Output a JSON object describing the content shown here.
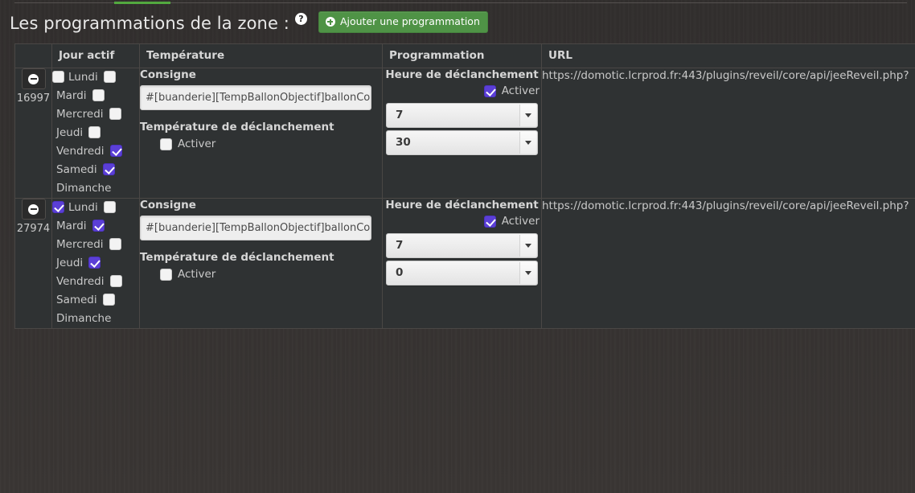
{
  "tabstrip": {
    "active_tab_color": "#53a93f"
  },
  "header": {
    "title": "Les programmations de la zone :",
    "help_icon": "question-mark-circle-icon",
    "add_button_label": "Ajouter une programmation",
    "add_button_color": "#4f9346"
  },
  "table": {
    "columns": [
      "",
      "Jour actif",
      "Température",
      "Programmation",
      "URL"
    ],
    "rows": [
      {
        "id": "16997",
        "remove_icon": "minus-circle-icon",
        "days": [
          {
            "label": "Lundi",
            "checked": false
          },
          {
            "label": "Mardi",
            "checked": false
          },
          {
            "label": "Mercredi",
            "checked": false
          },
          {
            "label": "Jeudi",
            "checked": false
          },
          {
            "label": "Vendredi",
            "checked": false
          },
          {
            "label": "Samedi",
            "checked": true
          },
          {
            "label": "Dimanche",
            "checked": true
          }
        ],
        "temperature": {
          "consigne_label": "Consigne",
          "consigne_value": "#[buanderie][TempBallonObjectif]ballonConsigne",
          "consigne_placeholder": "Consigne",
          "trigger_label": "Température de déclanchement",
          "trigger_activer_label": "Activer",
          "trigger_activer_checked": false
        },
        "programmation": {
          "heading": "Heure de déclanchement",
          "activer_label": "Activer",
          "activer_checked": true,
          "hour": "7",
          "minute": "30"
        },
        "url": "https://domotic.lcrprod.fr:443/plugins/reveil/core/api/jeeReveil.php?"
      },
      {
        "id": "27974",
        "remove_icon": "minus-circle-icon",
        "days": [
          {
            "label": "Lundi",
            "checked": true
          },
          {
            "label": "Mardi",
            "checked": false
          },
          {
            "label": "Mercredi",
            "checked": true
          },
          {
            "label": "Jeudi",
            "checked": false
          },
          {
            "label": "Vendredi",
            "checked": true
          },
          {
            "label": "Samedi",
            "checked": false
          },
          {
            "label": "Dimanche",
            "checked": false
          }
        ],
        "temperature": {
          "consigne_label": "Consigne",
          "consigne_value": "#[buanderie][TempBallonObjectif]ballonConsigne",
          "consigne_placeholder": "Consigne",
          "trigger_label": "Température de déclanchement",
          "trigger_activer_label": "Activer",
          "trigger_activer_checked": false
        },
        "programmation": {
          "heading": "Heure de déclanchement",
          "activer_label": "Activer",
          "activer_checked": true,
          "hour": "7",
          "minute": "0"
        },
        "url": "https://domotic.lcrprod.fr:443/plugins/reveil/core/api/jeeReveil.php?"
      }
    ]
  }
}
